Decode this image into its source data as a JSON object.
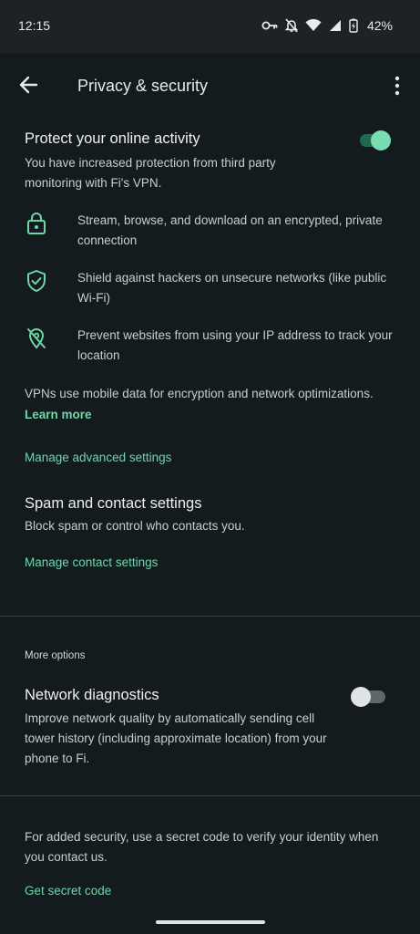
{
  "status_bar": {
    "time": "12:15",
    "battery": "42%"
  },
  "header": {
    "title": "Privacy & security"
  },
  "vpn": {
    "title": "Protect your online activity",
    "description": "You have increased protection from third party monitoring with Fi's VPN.",
    "toggle_on": true,
    "features": [
      {
        "icon": "lock-icon",
        "text": "Stream, browse, and download on an encrypted, private connection"
      },
      {
        "icon": "shield-check-icon",
        "text": "Shield against hackers on unsecure networks (like public Wi-Fi)"
      },
      {
        "icon": "location-off-icon",
        "text": "Prevent websites from using your IP address to track your location"
      }
    ],
    "note": "VPNs use mobile data for encryption and network optimizations.",
    "learn_more": "Learn more",
    "manage_advanced": "Manage advanced settings"
  },
  "spam": {
    "title": "Spam and contact settings",
    "description": "Block spam or control who contacts you.",
    "manage_contact": "Manage contact settings"
  },
  "more_options": {
    "label": "More options",
    "network_title": "Network diagnostics",
    "network_description": "Improve network quality by automatically sending cell tower history (including approximate location) from your phone to Fi.",
    "toggle_on": false
  },
  "secret": {
    "description": "For added security, use a secret code to verify your identity when you contact us.",
    "link": "Get secret code"
  },
  "colors": {
    "accent": "#6fd6a8",
    "background": "#141b1f"
  }
}
